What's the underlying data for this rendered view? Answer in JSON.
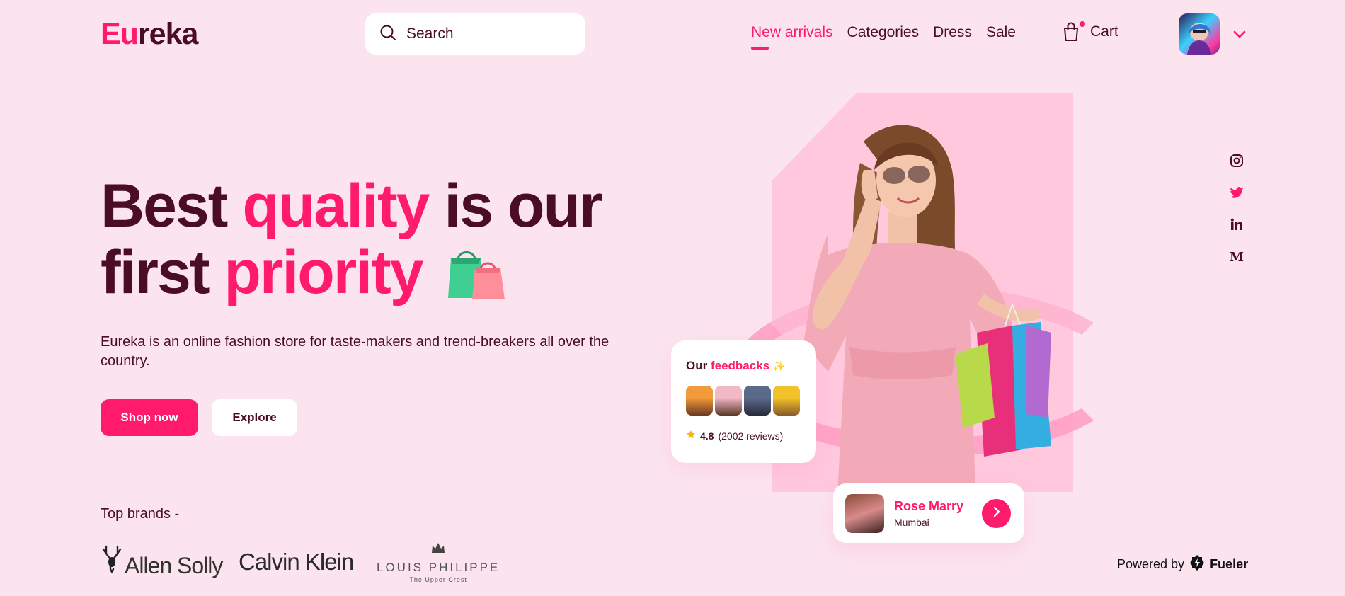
{
  "header": {
    "logo_part1": "Eu",
    "logo_part2": "reka",
    "search_placeholder": "Search",
    "nav": [
      {
        "label": "New arrivals",
        "active": true
      },
      {
        "label": "Categories",
        "active": false
      },
      {
        "label": "Dress",
        "active": false
      },
      {
        "label": "Sale",
        "active": false
      }
    ],
    "cart_label": "Cart"
  },
  "hero": {
    "headline_1": "Best",
    "headline_2": "quality",
    "headline_3": "is our",
    "headline_4": "first",
    "headline_5": "priority",
    "description": "Eureka is an online fashion store for taste-makers and trend-breakers all over the country.",
    "shop_button": "Shop now",
    "explore_button": "Explore"
  },
  "brands": {
    "label": "Top brands -",
    "items": [
      {
        "name": "Allen Solly"
      },
      {
        "name": "Calvin Klein"
      },
      {
        "name": "LOUIS PHILIPPE",
        "tagline": "The Upper Crest"
      }
    ]
  },
  "feedback": {
    "title_1": "Our",
    "title_2": "feedbacks",
    "sparkle": "✨",
    "rating": "4.8",
    "reviews": "(2002 reviews)",
    "face_colors": [
      "#f39a3a",
      "#f2b8c6",
      "#5a6a8a",
      "#f2c22a"
    ]
  },
  "profile": {
    "name": "Rose Marry",
    "city": "Mumbai"
  },
  "social": [
    "instagram-icon",
    "twitter-icon",
    "linkedin-icon",
    "medium-icon"
  ],
  "footer": {
    "powered_by": "Powered by",
    "brand": "Fueler"
  },
  "colors": {
    "accent": "#ff1a6b",
    "text": "#4a0d24",
    "background": "#fbe4ee"
  }
}
